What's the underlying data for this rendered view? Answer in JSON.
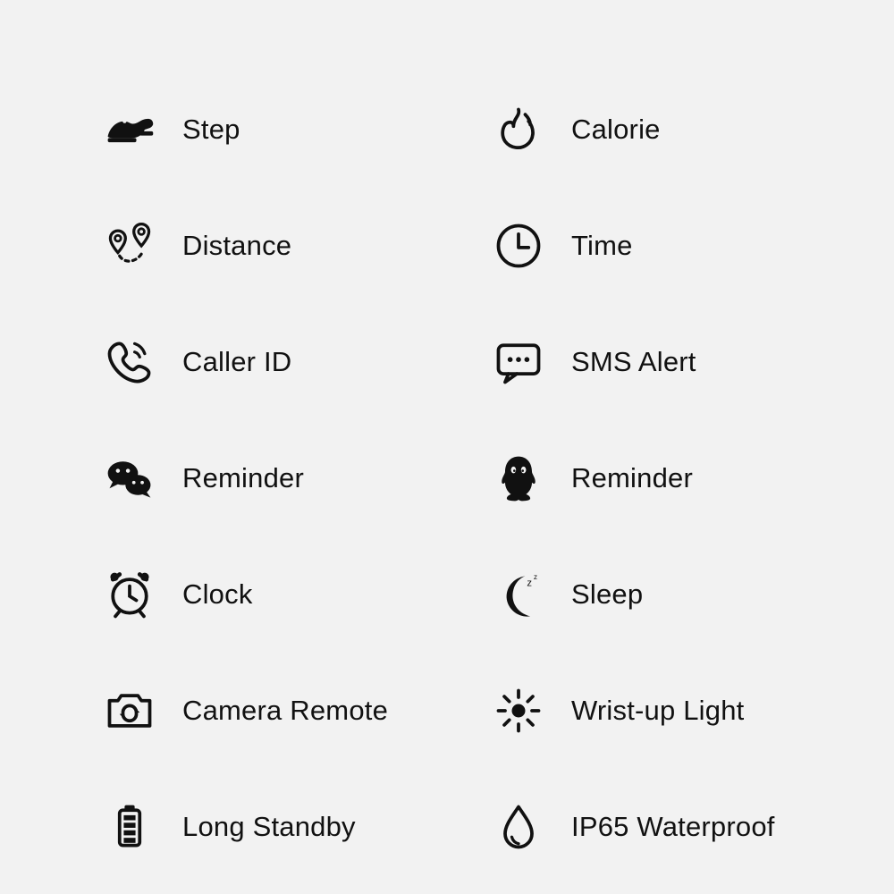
{
  "features": {
    "step": {
      "label": "Step",
      "icon": "shoe-icon"
    },
    "calorie": {
      "label": "Calorie",
      "icon": "flame-icon"
    },
    "distance": {
      "label": "Distance",
      "icon": "route-pins-icon"
    },
    "time": {
      "label": "Time",
      "icon": "clock-icon"
    },
    "caller_id": {
      "label": "Caller ID",
      "icon": "phone-ringing-icon"
    },
    "sms_alert": {
      "label": "SMS Alert",
      "icon": "sms-bubble-icon"
    },
    "wechat_remind": {
      "label": "Reminder",
      "icon": "wechat-icon"
    },
    "qq_remind": {
      "label": "Reminder",
      "icon": "qq-penguin-icon"
    },
    "alarm_clock": {
      "label": "Clock",
      "icon": "alarm-clock-icon"
    },
    "sleep": {
      "label": "Sleep",
      "icon": "moon-sleep-icon"
    },
    "camera_remote": {
      "label": "Camera Remote",
      "icon": "camera-rotate-icon"
    },
    "wrist_light": {
      "label": "Wrist-up Light",
      "icon": "brightness-icon"
    },
    "long_standby": {
      "label": "Long Standby",
      "icon": "battery-full-icon"
    },
    "waterproof": {
      "label": "IP65 Waterproof",
      "icon": "water-drop-icon"
    }
  },
  "colors": {
    "fg": "#111111",
    "bg": "#f2f2f2"
  }
}
